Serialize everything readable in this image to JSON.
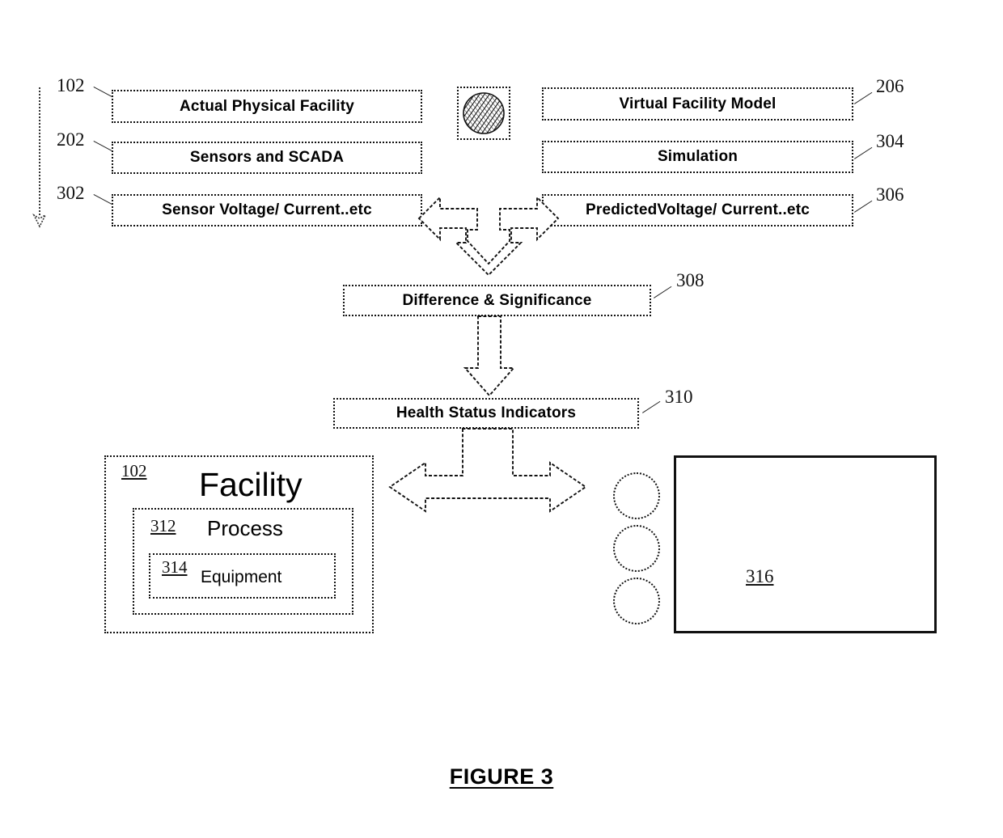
{
  "figure": {
    "caption": "FIGURE 3"
  },
  "colors": {
    "line": "#111111",
    "background": "#ffffff",
    "text": "#000000"
  },
  "left_column": {
    "boxes": [
      {
        "ref": "102",
        "label": "Actual Physical Facility"
      },
      {
        "ref": "202",
        "label": "Sensors and SCADA"
      },
      {
        "ref": "302",
        "label": "Sensor Voltage/ Current..etc"
      }
    ]
  },
  "right_column": {
    "boxes": [
      {
        "ref": "206",
        "label": "Virtual Facility Model"
      },
      {
        "ref": "304",
        "label": "Simulation"
      },
      {
        "ref": "306",
        "label": "PredictedVoltage/ Current..etc"
      }
    ]
  },
  "center": {
    "icon": "hatched-circle-icon",
    "difference_box": {
      "ref": "308",
      "label": "Difference & Significance"
    },
    "health_box": {
      "ref": "310",
      "label": "Health Status Indicators"
    }
  },
  "facility_panel": {
    "ref": "102",
    "title": "Facility",
    "process": {
      "ref": "312",
      "title": "Process"
    },
    "equipment": {
      "ref": "314",
      "title": "Equipment"
    }
  },
  "display_panel": {
    "ref": "316",
    "lamp_count": 3
  }
}
